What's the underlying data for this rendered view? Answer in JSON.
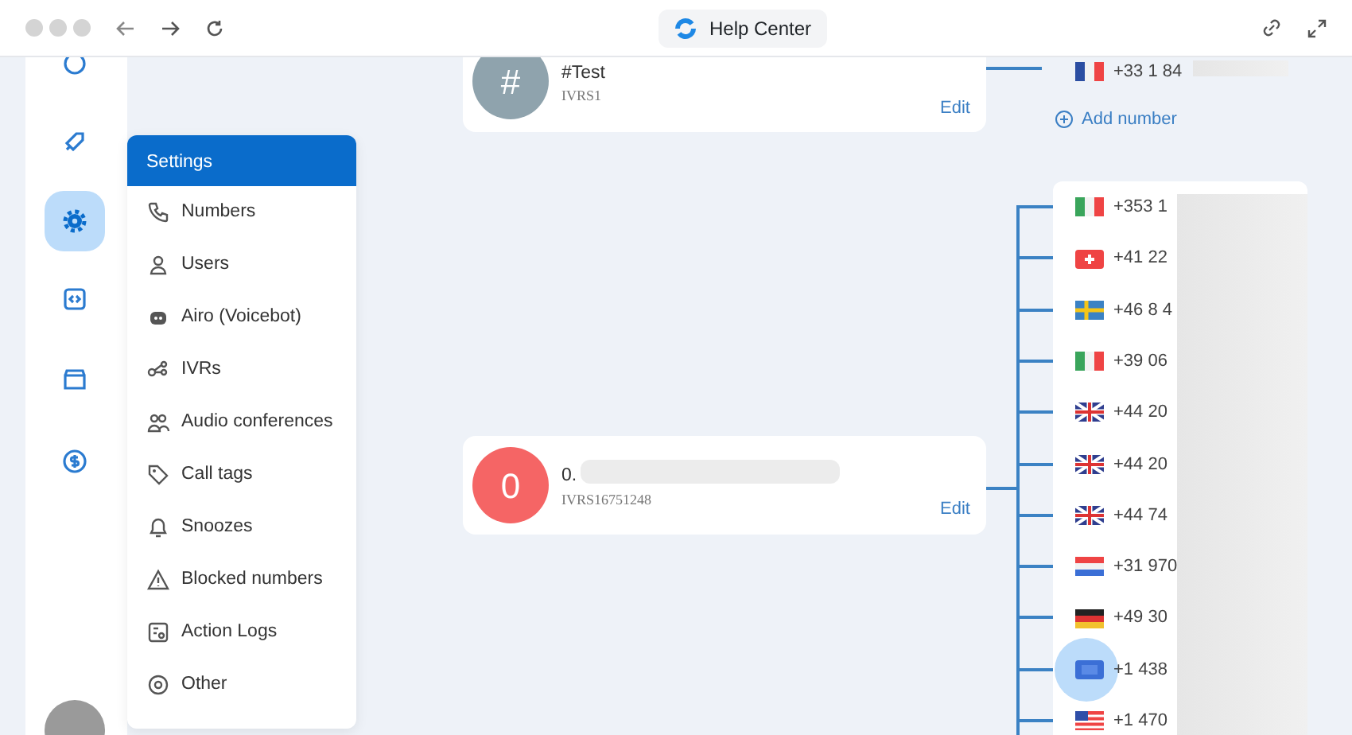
{
  "browser": {
    "title": "Help Center"
  },
  "rail": {
    "items": [
      {
        "selected": false
      },
      {
        "selected": false
      },
      {
        "selected": true
      },
      {
        "selected": false
      },
      {
        "selected": false
      },
      {
        "selected": false
      }
    ]
  },
  "settings_menu": {
    "title": "Settings",
    "items": [
      {
        "label": "Numbers"
      },
      {
        "label": "Users"
      },
      {
        "label": "Airo (Voicebot)"
      },
      {
        "label": "IVRs"
      },
      {
        "label": "Audio conferences"
      },
      {
        "label": "Call tags"
      },
      {
        "label": "Snoozes"
      },
      {
        "label": "Blocked numbers"
      },
      {
        "label": "Action Logs"
      },
      {
        "label": "Other"
      }
    ]
  },
  "ivrs": [
    {
      "avatar": "#",
      "name": "#Test",
      "id": "IVRS1",
      "edit": "Edit",
      "color": "#8fa3ad",
      "numbers": [
        {
          "kind": "fr",
          "number": "+33 1 84",
          "highlighted": false
        }
      ],
      "add_number": "Add number"
    },
    {
      "avatar": "0",
      "name": "0.",
      "id": "IVRS16751248",
      "edit": "Edit",
      "color": "#f56565",
      "numbers": [
        {
          "kind": "it",
          "number": "+353 1",
          "highlighted": false
        },
        {
          "kind": "ch",
          "number": "+41 22",
          "highlighted": false
        },
        {
          "kind": "se",
          "number": "+46 8 4",
          "highlighted": false
        },
        {
          "kind": "it",
          "number": "+39 06",
          "highlighted": false
        },
        {
          "kind": "gb",
          "number": "+44 20",
          "highlighted": false
        },
        {
          "kind": "gb",
          "number": "+44 20",
          "highlighted": false
        },
        {
          "kind": "gb",
          "number": "+44 74",
          "highlighted": false
        },
        {
          "kind": "nl",
          "number": "+31 970",
          "highlighted": false
        },
        {
          "kind": "de",
          "number": "+49 30",
          "highlighted": false
        },
        {
          "kind": "blue",
          "number": "+1 438",
          "highlighted": true
        },
        {
          "kind": "us",
          "number": "+1 470",
          "highlighted": false
        }
      ]
    }
  ]
}
